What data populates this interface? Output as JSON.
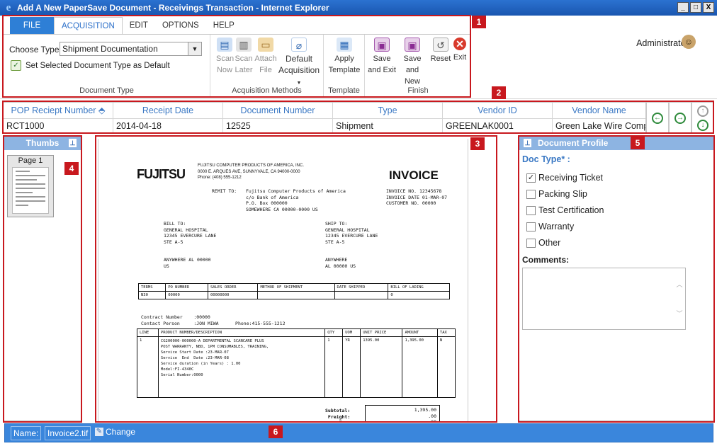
{
  "window": {
    "title": "Add A New PaperSave Document - Receivings Transaction - Internet Explorer",
    "controls": [
      "_",
      "□",
      "X"
    ]
  },
  "user": {
    "name": "Administrator▾"
  },
  "tabs": [
    {
      "label": "FILE"
    },
    {
      "label": "ACQUISITION"
    },
    {
      "label": "EDIT"
    },
    {
      "label": "OPTIONS"
    },
    {
      "label": "HELP"
    }
  ],
  "ribbon": {
    "doc_type": {
      "choose_label": "Choose Type:",
      "selected": "Shipment Documentation",
      "set_default": "Set Selected Document Type as Default",
      "group_label": "Document Type"
    },
    "acq": {
      "scan_now": [
        "Scan",
        "Now"
      ],
      "scan_later": [
        "Scan",
        "Later"
      ],
      "attach_file": [
        "Attach",
        "File"
      ],
      "default_acq": [
        "Default",
        "Acquisition"
      ],
      "group_label": "Acquisition Methods"
    },
    "template": {
      "apply": [
        "Apply",
        "Template"
      ],
      "group_label": "Template"
    },
    "finish": {
      "save_exit": [
        "Save",
        "and Exit"
      ],
      "save_new": [
        "Save",
        "and New"
      ],
      "reset": "Reset",
      "exit": "Exit",
      "group_label": "Finish"
    }
  },
  "grid": {
    "headers": [
      "POP Reciept Number ⬘",
      "Receipt Date",
      "Document Number",
      "Type",
      "Vendor ID",
      "Vendor Name"
    ],
    "row": [
      "RCT1000",
      "2014-04-18",
      "12525",
      "Shipment",
      "GREENLAK0001",
      "Green Lake Wire Compa"
    ]
  },
  "thumbs": {
    "title": "Thumbs",
    "page_label": "Page 1"
  },
  "invoice": {
    "logo": "FUJITSU",
    "title": "INVOICE",
    "company": "FUJITSU COMPUTER PRODUCTS OF AMERICA, INC.\n0000 E. ARQUES AVE, SUNNYVALE, CA 94000-0000\nPhone: (408) 555-1212",
    "remit_label": "REMIT TO:",
    "remit": "Fujitsu Computer Products of America\nc/o Bank of America\nP.O. Box 000000\nSOMEWHERE CA 00000-0000 US",
    "inv_info": "INVOICE NO. 12345678\nINVOICE DATE 01-MAR-07\nCUSTOMER NO. 00000",
    "bill_to": "BILL TO:\nGENERAL HOSPITAL\n12345 EVERCURE LANE\nSTE A-5\n\n\nANYWHERE AL 00000\nUS",
    "ship_to": "SHIP TO:\nGENERAL HOSPITAL\n12345 EVERCURE LANE\nSTE A-5\n\n\nANYWHERE\nAL 00000 US",
    "terms_headers": [
      "TERMS",
      "PO NUMBER",
      "SALES ORDER",
      "METHOD OF SHIPMENT",
      "DATE SHIPPED",
      "BILL OF LADING"
    ],
    "terms_values": [
      "N30",
      "00000",
      "00000000",
      "",
      "",
      "0"
    ],
    "contract": "Contract Number    :00000\nContact Person     :JON MIWA      Phone:415-555-1212",
    "line_headers": [
      "LINE",
      "PRODUCT NUMBER/DESCRIPTION",
      "QTY",
      "UOM",
      "UNIT PRICE",
      "AMOUNT",
      "TAX"
    ],
    "line_values": [
      "1",
      "CG200000-000000-A DEPARTMENTAL SCANCARE PLUS\nPOST WARRANTY, NBD, 1PM CONSUMABLES, TRAINING,\nService Start Date :23-MAR-07\nService  End  Date :23-MAR-08\nService duration (in Years) : 1.00\nModel:FI-4340C\nSerial Number:0000",
      "1",
      "YR",
      "1395.00",
      "1,395.00",
      "N"
    ],
    "totals": "Subtotal:\nFreight:\nTax:",
    "totals_values": "1,395.00\n.00\n.00"
  },
  "profile": {
    "title": "Document Profile",
    "doc_type_label": "Doc Type* :",
    "options": [
      {
        "label": "Receiving Ticket",
        "checked": true
      },
      {
        "label": "Packing Slip",
        "checked": false
      },
      {
        "label": "Test Certification",
        "checked": false
      },
      {
        "label": "Warranty",
        "checked": false
      },
      {
        "label": "Other",
        "checked": false
      }
    ],
    "comments_label": "Comments:"
  },
  "status": {
    "name_label": "Name:",
    "file_name": "Invoice2.tif",
    "change_label": "Change"
  },
  "callouts": [
    "1",
    "2",
    "3",
    "4",
    "5",
    "6"
  ],
  "colors": {
    "accent": "#2e7fd6",
    "callout": "#c8181e",
    "panel_header": "#8db4e2",
    "status_bar": "#3a86dc"
  }
}
